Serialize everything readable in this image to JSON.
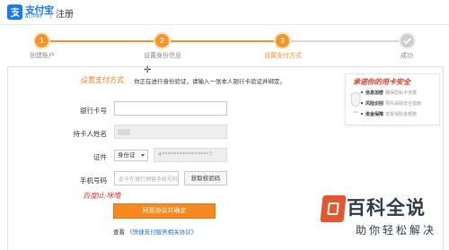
{
  "header": {
    "logo_cn": "支付宝",
    "logo_en": "ALIPAY",
    "page_title": "注册"
  },
  "steps": [
    {
      "number": "1",
      "label": "创建账户",
      "status": "done"
    },
    {
      "number": "2",
      "label": "设置身份信息",
      "status": "done"
    },
    {
      "number": "3",
      "label": "设置支付方式",
      "status": "active"
    },
    {
      "number": "",
      "label": "成功",
      "status": "pending"
    }
  ],
  "section": {
    "title": "设置支付方式",
    "tip": "你正在进行身份验证，请输入一张本人银行卡验证并绑定。"
  },
  "form": {
    "card_number_label": "银行卡号",
    "cardholder_label": "持卡人姓名",
    "id_label": "证件",
    "id_type": "身份证",
    "id_number_masked": "4****************7",
    "phone_label": "手机号码",
    "phone_placeholder": "此卡在银行预留手机号码",
    "get_code_button": "获取校验码",
    "submit_button": "同意协议并确定",
    "agree_prefix": "查看",
    "agree_link": "《快捷支付服务相关协议》"
  },
  "annotation": {
    "baidu_text": "百度id:咪噜"
  },
  "promise": {
    "title": "承诺你的用卡安全",
    "rows": [
      {
        "name": "信息加密",
        "desc": "确保隐私不泄露"
      },
      {
        "name": "风险识别",
        "desc": "预先采取安全措施"
      },
      {
        "name": "资金保障",
        "desc": "享受保险金额赔"
      }
    ]
  },
  "watermark": {
    "big": "百科全说",
    "small": "助你轻松解决"
  },
  "colors": {
    "brand_blue": "#1677ff",
    "accent_orange": "#f7931e",
    "link_blue": "#1a6fd8"
  }
}
